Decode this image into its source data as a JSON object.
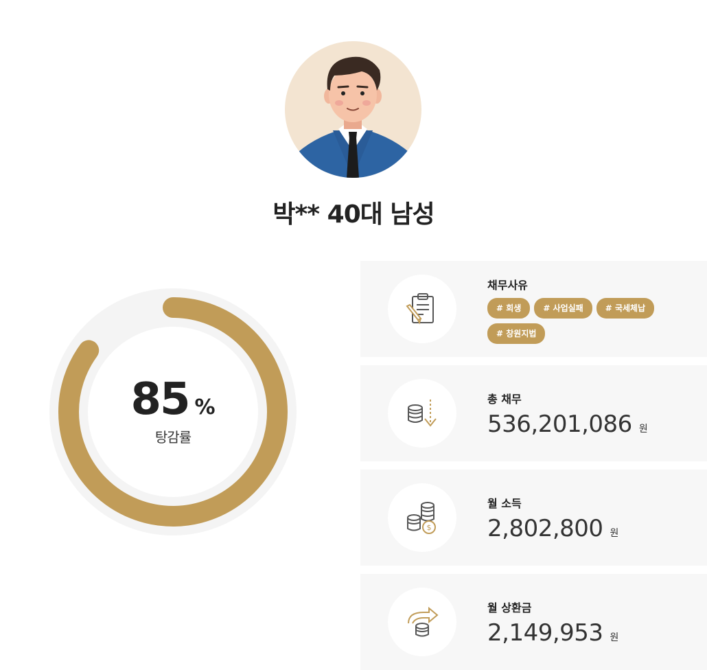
{
  "profile": {
    "name": "박** 40대 남성",
    "avatar": "man-in-blue-suit-avatar"
  },
  "gauge": {
    "value": "85",
    "unit": "%",
    "label": "탕감률",
    "percent": 85,
    "colors": {
      "fill": "#c19c58",
      "track": "#f4f4f4"
    }
  },
  "cards": {
    "reason": {
      "icon": "clipboard-pencil-icon",
      "label": "채무사유",
      "tags": [
        "# 회생",
        "# 사업실패",
        "# 국세체납",
        "# 창원지법"
      ]
    },
    "total_debt": {
      "icon": "coins-down-arrow-icon",
      "label": "총 채무",
      "value": "536,201,086",
      "unit": "원"
    },
    "monthly_income": {
      "icon": "coins-stack-icon",
      "label": "월 소득",
      "value": "2,802,800",
      "unit": "원"
    },
    "monthly_repayment": {
      "icon": "coins-return-arrow-icon",
      "label": "월 상환금",
      "value": "2,149,953",
      "unit": "원"
    }
  },
  "colors": {
    "accent": "#c19c58",
    "card_bg": "#f7f7f7",
    "icon_stroke": "#555555"
  }
}
